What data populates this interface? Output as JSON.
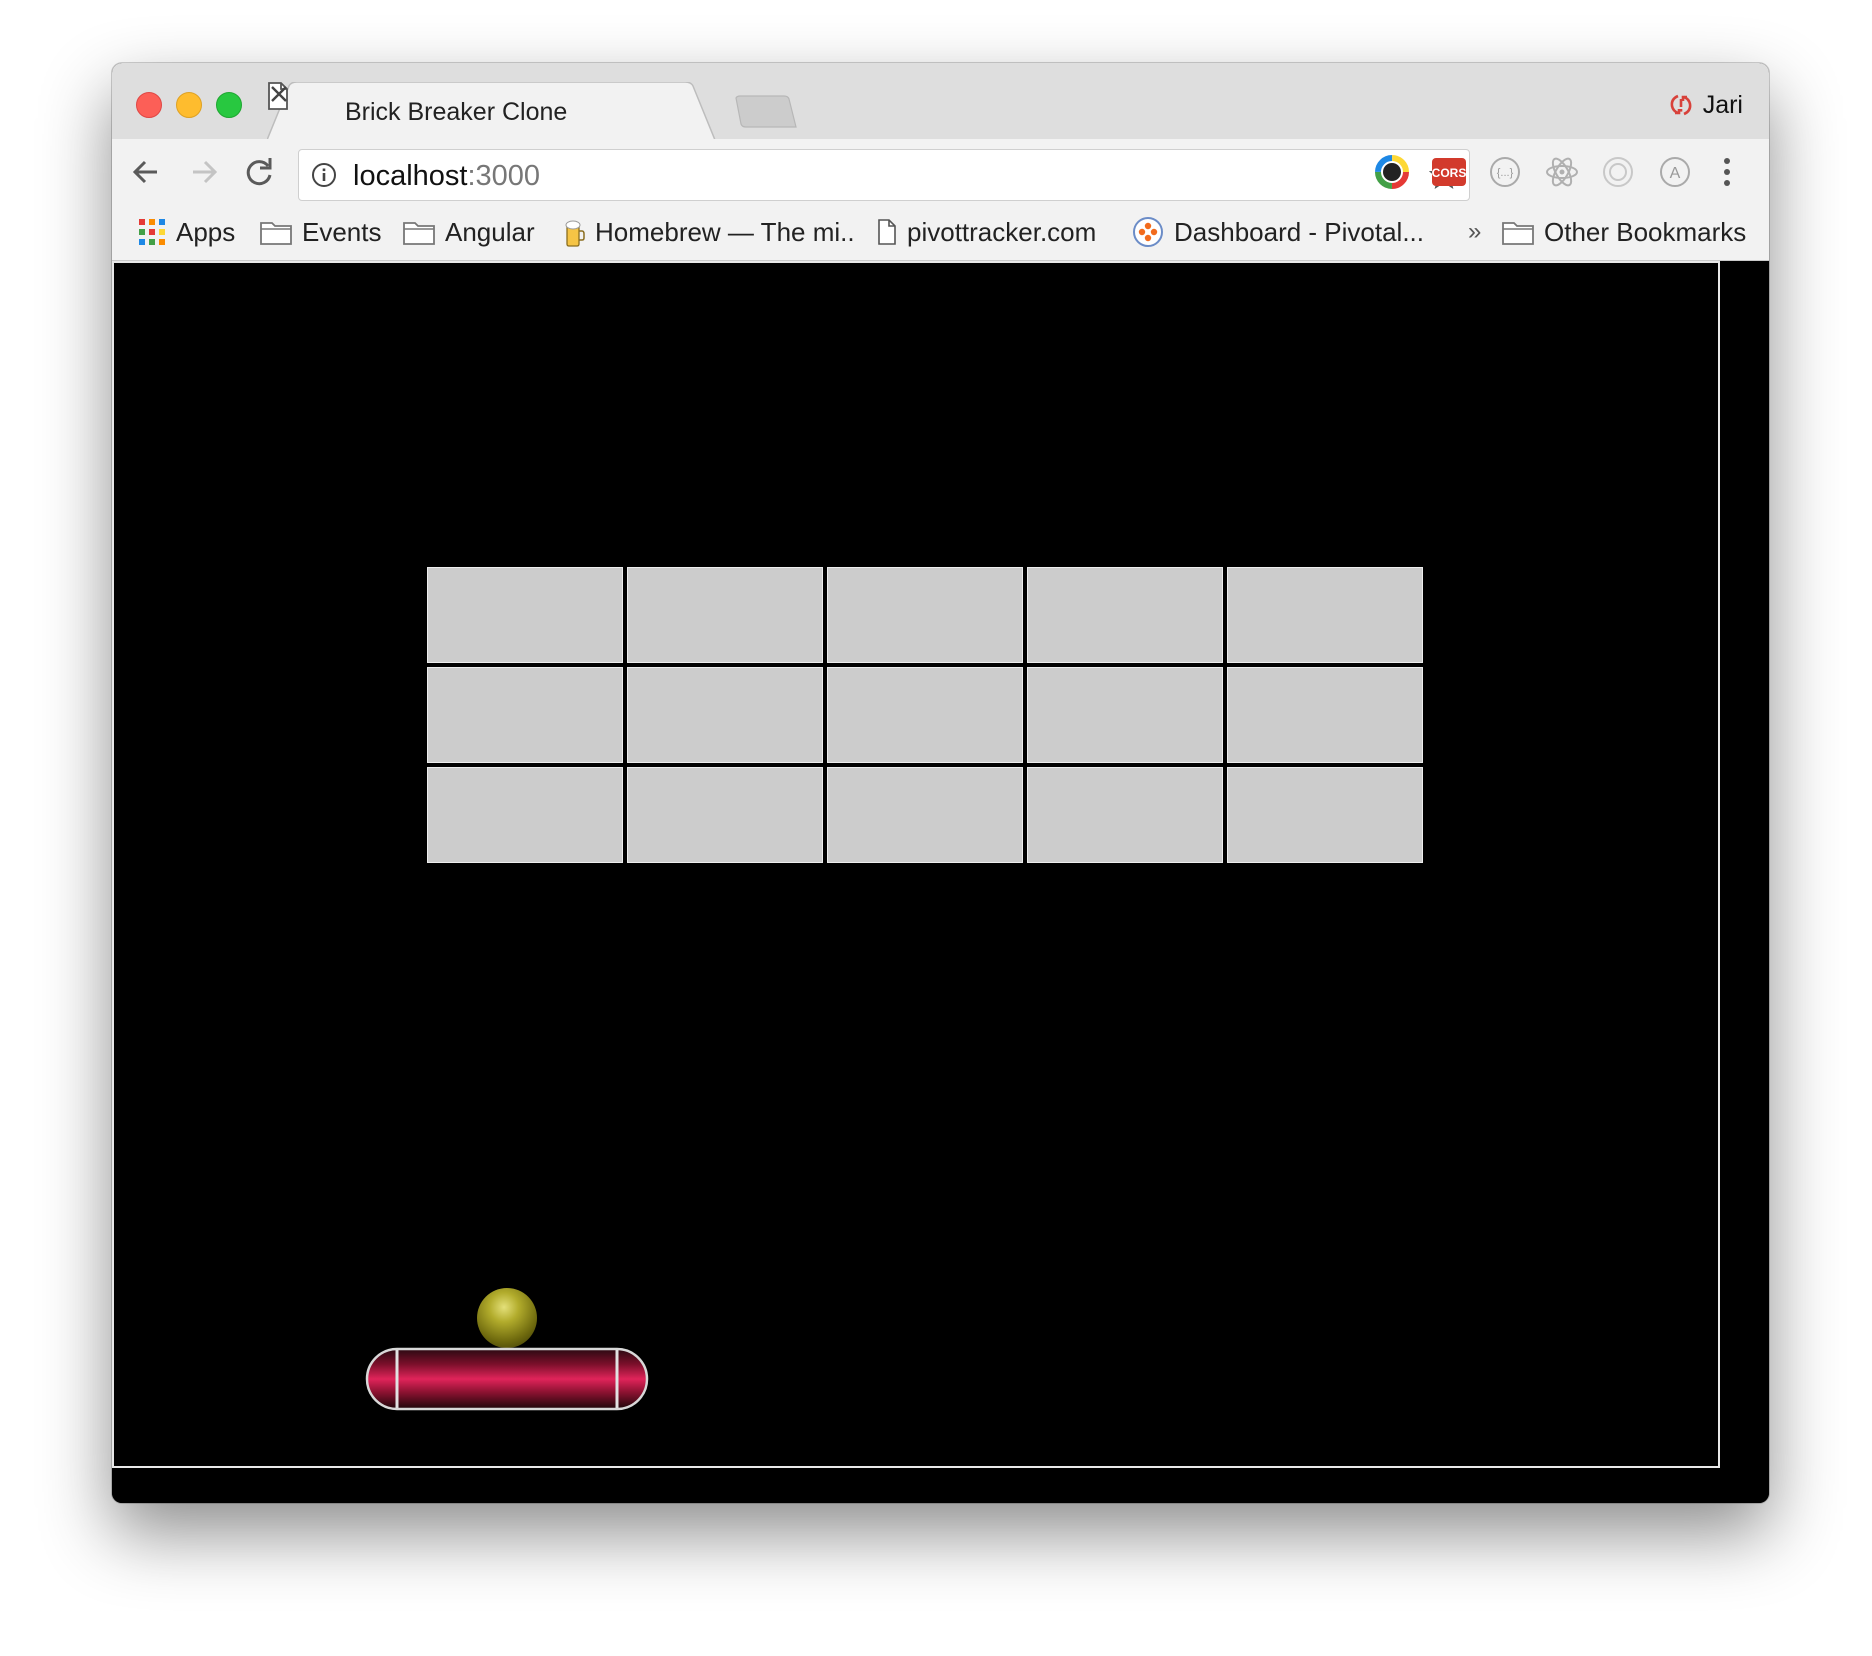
{
  "browser": {
    "tab": {
      "title": "Brick Breaker Clone"
    },
    "profile": {
      "name": "Jari"
    },
    "address": {
      "host": "localhost",
      "port": ":3000"
    },
    "bookmarks": [
      {
        "label": "Apps",
        "icon": "apps-grid-icon"
      },
      {
        "label": "Events",
        "icon": "folder-icon"
      },
      {
        "label": "Angular",
        "icon": "folder-icon"
      },
      {
        "label": "Homebrew — The mi..",
        "icon": "homebrew-icon"
      },
      {
        "label": "pivottracker.com",
        "icon": "page-icon"
      },
      {
        "label": "Dashboard - Pivotal...",
        "icon": "pivotal-icon"
      }
    ],
    "overflow": "»",
    "other_bookmarks": "Other Bookmarks",
    "extensions": [
      "color-wheel-extension-icon",
      "cors-extension-icon",
      "json-extension-icon",
      "react-devtools-icon",
      "target-extension-icon",
      "font-extension-icon"
    ],
    "extension_labels": {
      "cors": "CORS",
      "font": "A"
    }
  },
  "game": {
    "brick_rows": 3,
    "brick_columns": 5,
    "bricks_remaining": 15,
    "colors": {
      "background": "#000000",
      "brick": "#cccccc",
      "ball": "#b2ac2c",
      "paddle": "#c8143f"
    }
  }
}
